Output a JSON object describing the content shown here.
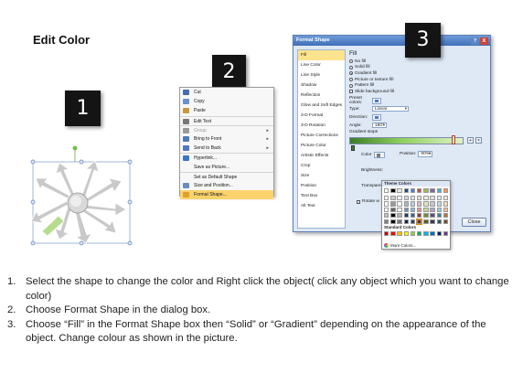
{
  "title": "Edit Color",
  "badges": [
    "1",
    "2",
    "3"
  ],
  "context_menu": {
    "items": [
      {
        "label": "Cut",
        "underline": "t",
        "icon": "scissors-icon",
        "color": "#4a6aa8"
      },
      {
        "label": "Copy",
        "icon": "copy-icon",
        "color": "#6d8fc7"
      },
      {
        "label": "Paste",
        "icon": "paste-icon",
        "color": "#c89a3c"
      },
      {
        "label": "Edit Text",
        "icon": "text-icon",
        "color": "#777777",
        "separator": true
      },
      {
        "label": "Group",
        "icon": "group-icon",
        "color": "#999999",
        "submenu": true,
        "disabled": true,
        "separator": true
      },
      {
        "label": "Bring to Front",
        "icon": "bring-front-icon",
        "color": "#4f79be",
        "submenu": true
      },
      {
        "label": "Send to Back",
        "icon": "send-back-icon",
        "color": "#4f79be",
        "submenu": true
      },
      {
        "label": "Hyperlink...",
        "icon": "hyperlink-icon",
        "color": "#3a74c9",
        "separator": true
      },
      {
        "label": "Save as Picture...",
        "icon": "",
        "color": ""
      },
      {
        "label": "Set as Default Shape",
        "icon": "",
        "color": "",
        "separator": true
      },
      {
        "label": "Size and Position...",
        "icon": "size-icon",
        "color": "#6a8cc0"
      },
      {
        "label": "Format Shape...",
        "icon": "format-shape-icon",
        "color": "#e0a030",
        "highlighted": true
      }
    ]
  },
  "dialog": {
    "title": "Format Shape",
    "help": "?",
    "close": "X",
    "nav": [
      "Fill",
      "Line Color",
      "Line Style",
      "Shadow",
      "Reflection",
      "Glow and Soft Edges",
      "3-D Format",
      "3-D Rotation",
      "Picture Corrections",
      "Picture Color",
      "Artistic Effects",
      "Crop",
      "Size",
      "Position",
      "Text Box",
      "Alt Text"
    ],
    "panel_title": "Fill",
    "fill_options": [
      {
        "label": "No fill",
        "checked": false
      },
      {
        "label": "Solid fill",
        "checked": false
      },
      {
        "label": "Gradient fill",
        "checked": true
      },
      {
        "label": "Picture or texture fill",
        "checked": false
      },
      {
        "label": "Pattern fill",
        "checked": false
      }
    ],
    "slide_bg": "Slide background fill",
    "preset_colors": "Preset colors:",
    "type_label": "Type:",
    "type_value": "Linear",
    "direction_label": "Direction:",
    "angle_label": "Angle:",
    "angle_value": "180°",
    "gradient_stops": "Gradient stops",
    "color_label": "Color",
    "position_label": "Position:",
    "position_value": "90%",
    "brightness_label": "Brightness:",
    "transparency_label": "Transparency:",
    "rotate_label": "Rotate w",
    "close_button": "Close"
  },
  "palette": {
    "theme_title": "Theme Colors",
    "standard_title": "Standard Colors",
    "more": "More Colors...",
    "theme_top": [
      "#ffffff",
      "#000000",
      "#eeece1",
      "#1f497d",
      "#4f81bd",
      "#c0504d",
      "#9bbb59",
      "#8064a2",
      "#4bacc6",
      "#f79646"
    ],
    "standard": [
      "#c00000",
      "#ff0000",
      "#ffc000",
      "#ffff00",
      "#92d050",
      "#00b050",
      "#00b0f0",
      "#0070c0",
      "#002060",
      "#7030a0"
    ]
  },
  "instructions": [
    {
      "num": "1.",
      "text": "Select the shape to change the color and Right click the object( click any object which you want to change color)"
    },
    {
      "num": "2.",
      "text": "Choose Format Shape in the dialog box."
    },
    {
      "num": "3.",
      "text": "Choose “Fill” in the Format Shape box then “Solid” or “Gradient” depending on the appearance of the object. Change colour as shown in the picture."
    }
  ]
}
